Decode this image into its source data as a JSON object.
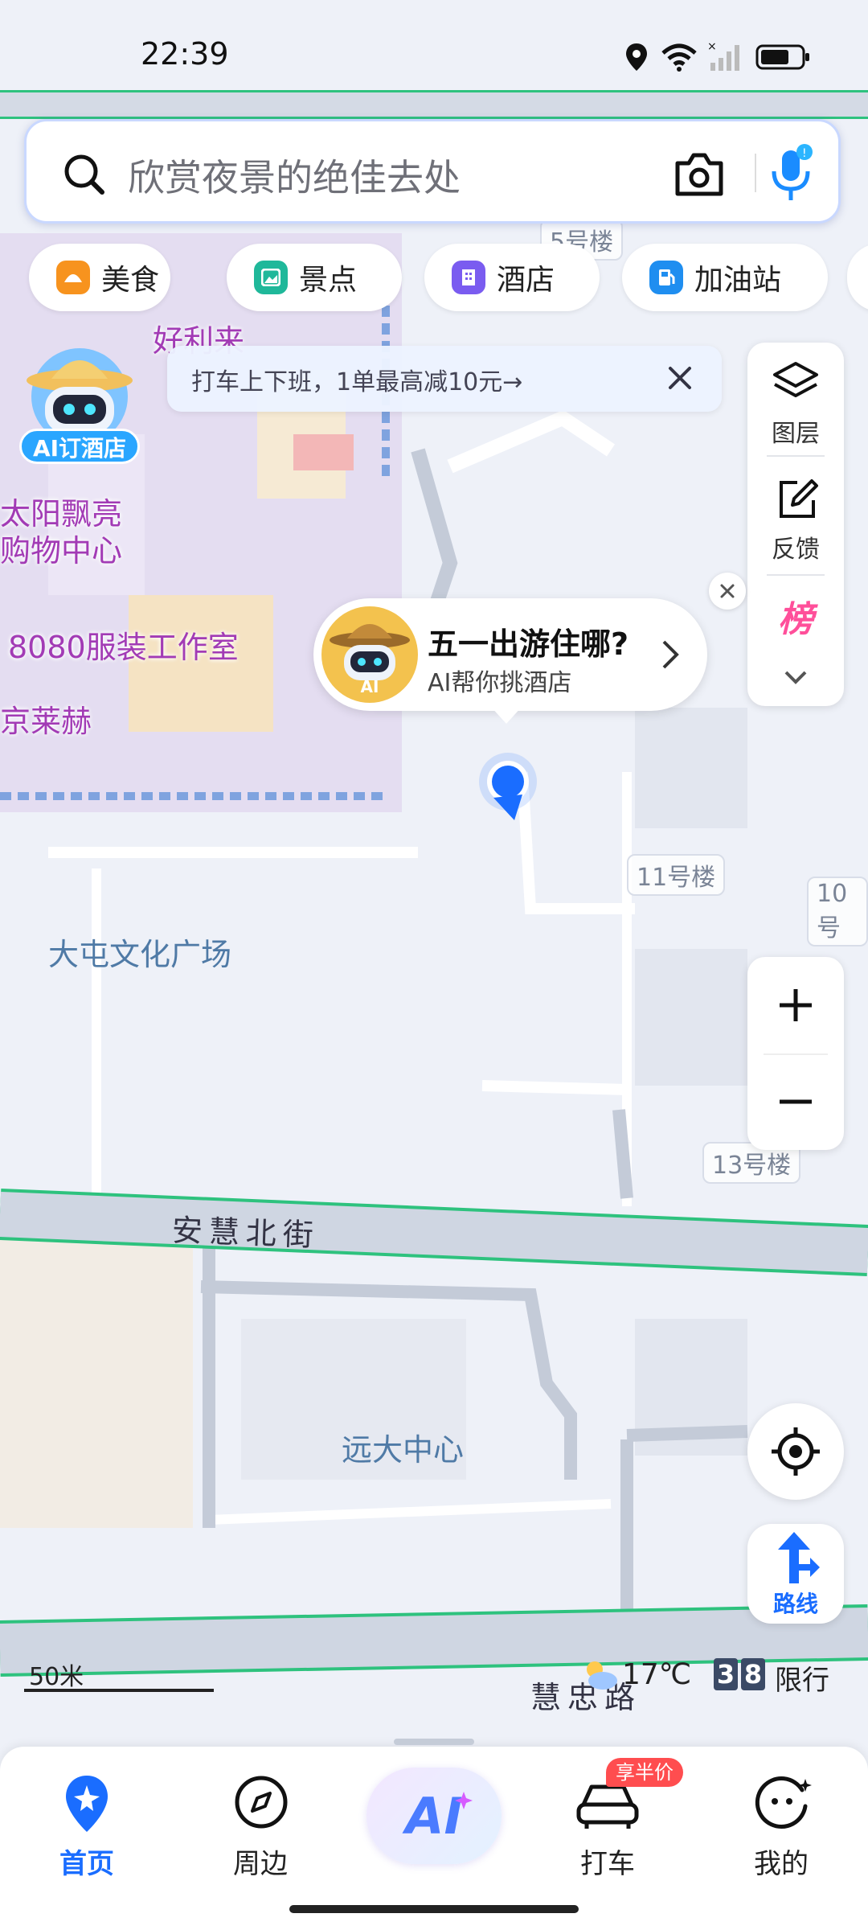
{
  "status_bar": {
    "time": "22:39"
  },
  "search": {
    "placeholder": "欣赏夜景的绝佳去处"
  },
  "categories": [
    {
      "label": "美食",
      "color": "#f7931e"
    },
    {
      "label": "景点",
      "color": "#1fb89a"
    },
    {
      "label": "酒店",
      "color": "#7a5cf0"
    },
    {
      "label": "加油站",
      "color": "#1f8ef0"
    }
  ],
  "promo": {
    "text": "打车上下班，1单最高减10元→"
  },
  "ai_hotel_badge": {
    "label": "AI订酒店"
  },
  "map_tools": {
    "layers": "图层",
    "feedback": "反馈",
    "rank": "榜"
  },
  "ai_bubble": {
    "title": "五一出游住哪?",
    "subtitle": "AI帮你挑酒店",
    "badge": "AI"
  },
  "map_labels": {
    "poi_haolilai": "好利来",
    "poi_mall_line1": "太阳飘亮",
    "poi_mall_line2": "购物中心",
    "poi_studio": "8080服装工作室",
    "poi_jinglaihe": "京莱赫",
    "area_plaza": "大屯文化广场",
    "area_center": "远大中心",
    "road_north": "安慧北街",
    "road_bottom": "慧忠路",
    "bldg_5": "5号楼",
    "bldg_11": "11号楼",
    "bldg_10": "10号",
    "bldg_13": "13号楼"
  },
  "scale": {
    "label": "50米"
  },
  "weather": {
    "temp": "17℃"
  },
  "traffic_limit": {
    "digits": [
      "3",
      "8"
    ],
    "label": "限行"
  },
  "route_button": {
    "label": "路线"
  },
  "bottom_nav": {
    "home": "首页",
    "nearby": "周边",
    "ai": "AI",
    "taxi": "打车",
    "taxi_badge": "享半价",
    "me": "我的"
  },
  "colors": {
    "brand_blue": "#1a6dff",
    "road_green": "#2ec27e",
    "poi_purple": "#a23bb5"
  }
}
